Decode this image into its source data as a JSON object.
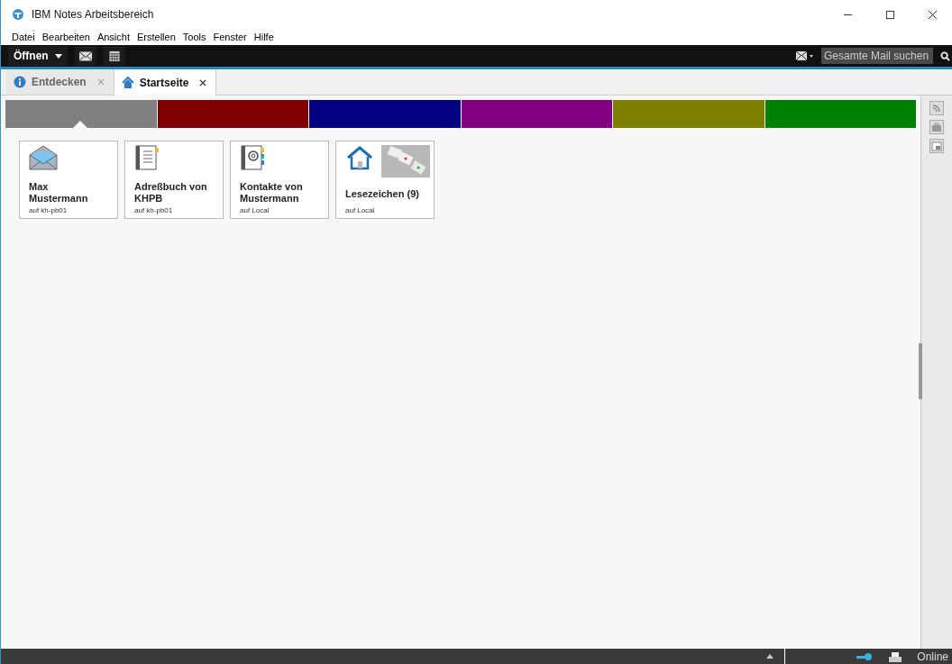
{
  "window": {
    "title": "IBM Notes Arbeitsbereich"
  },
  "menu": [
    "Datei",
    "Bearbeiten",
    "Ansicht",
    "Erstellen",
    "Tools",
    "Fenster",
    "Hilfe"
  ],
  "toolbar": {
    "open_label": "Öffnen",
    "search": {
      "placeholder": "Gesamte Mail suchen"
    }
  },
  "tabs": [
    {
      "label": "Entdecken",
      "selected": false,
      "kind": "info"
    },
    {
      "label": "Startseite",
      "selected": true,
      "kind": "home"
    }
  ],
  "pages": [
    {
      "color": "#808080",
      "selected": true
    },
    {
      "color": "#800000",
      "selected": false
    },
    {
      "color": "#000080",
      "selected": false
    },
    {
      "color": "#800080",
      "selected": false
    },
    {
      "color": "#808000",
      "selected": false
    },
    {
      "color": "#008000",
      "selected": false
    }
  ],
  "tiles": [
    {
      "kind": "mail",
      "title": "Max Mustermann",
      "subtitle": "auf kh-pb01"
    },
    {
      "kind": "addressbook",
      "title": "Adreßbuch von KHPB",
      "subtitle": "auf kh-pb01"
    },
    {
      "kind": "contacts",
      "title": "Kontakte von Mustermann",
      "subtitle": "auf Local"
    },
    {
      "kind": "bookmarks",
      "title": "Lesezeichen (9)",
      "subtitle": "auf Local"
    }
  ],
  "status_bar": {
    "status": "Online"
  }
}
